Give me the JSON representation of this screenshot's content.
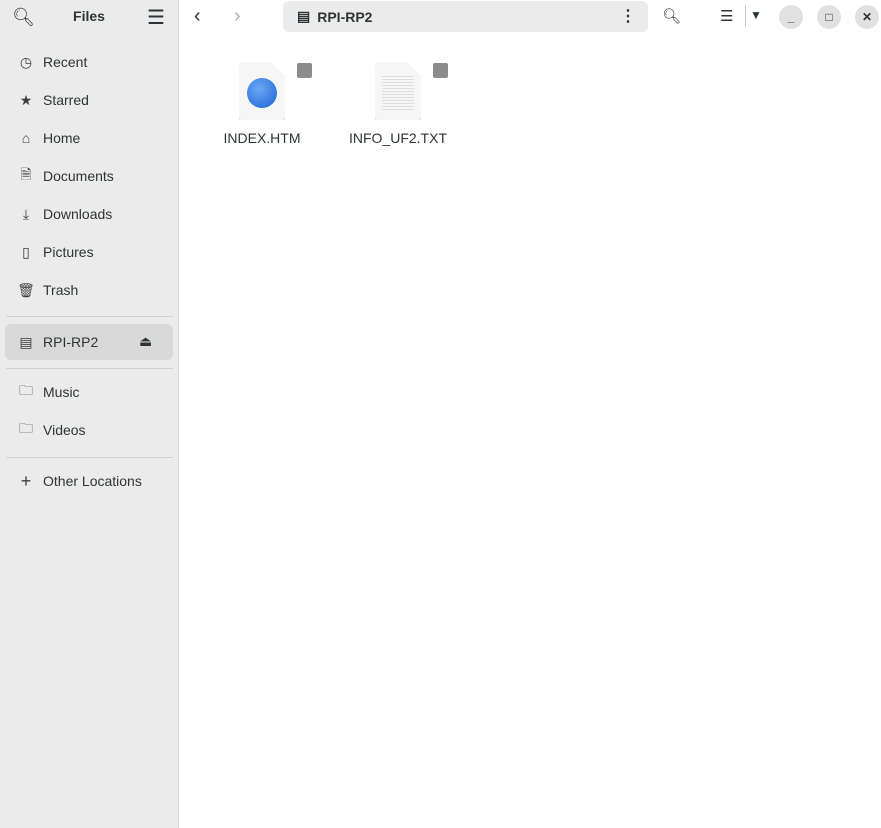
{
  "header": {
    "title": "Files",
    "path": "RPI-RP2"
  },
  "sidebar": {
    "items": [
      {
        "label": "Recent",
        "icon": "clock-icon"
      },
      {
        "label": "Starred",
        "icon": "star-icon"
      },
      {
        "label": "Home",
        "icon": "home-icon"
      },
      {
        "label": "Documents",
        "icon": "document-icon"
      },
      {
        "label": "Downloads",
        "icon": "download-icon"
      },
      {
        "label": "Pictures",
        "icon": "picture-icon"
      },
      {
        "label": "Trash",
        "icon": "trash-icon"
      }
    ],
    "device": {
      "label": "RPI-RP2"
    },
    "bookmarks": [
      {
        "label": "Music"
      },
      {
        "label": "Videos"
      }
    ],
    "other": "Other Locations"
  },
  "files": [
    {
      "name": "INDEX.HTM",
      "type": "html"
    },
    {
      "name": "INFO_UF2.TXT",
      "type": "text"
    }
  ]
}
